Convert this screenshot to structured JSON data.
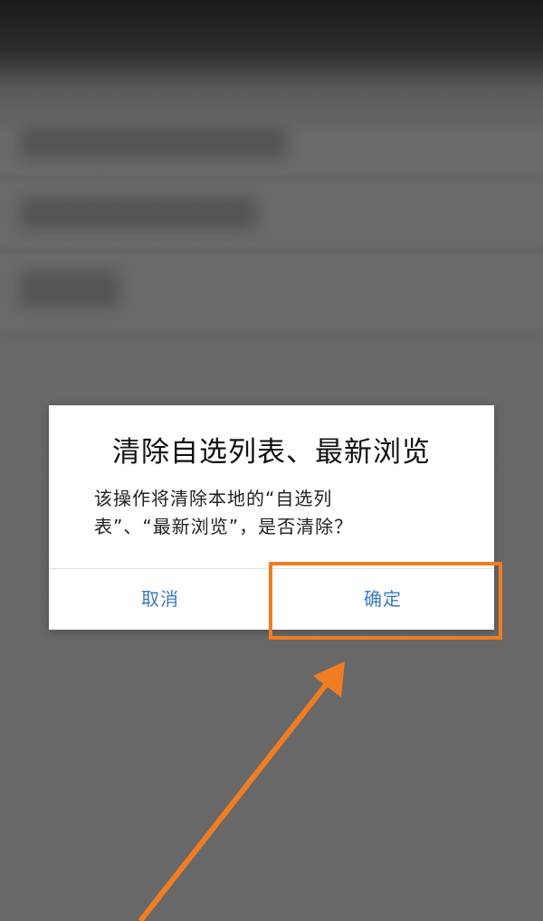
{
  "dialog": {
    "title": "清除自选列表、最新浏览",
    "message": "该操作将清除本地的“自选列表”、“最新浏览”，是否清除？",
    "cancel_label": "取消",
    "confirm_label": "确定"
  },
  "colors": {
    "overlay_background": "#676767",
    "dialog_background": "#ffffff",
    "button_text": "#3b78c6",
    "annotation_orange": "#f07d22"
  },
  "icons": {
    "annotation": "arrow-pointer-icon"
  }
}
